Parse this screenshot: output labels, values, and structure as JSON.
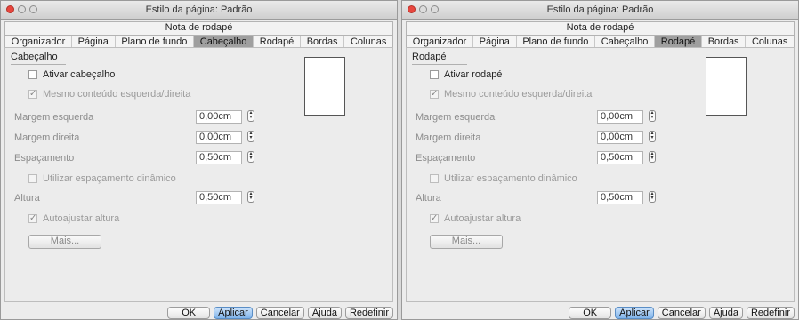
{
  "left": {
    "title": "Estilo da página: Padrão",
    "tabs_row1": "Nota de rodapé",
    "tabs": [
      "Organizador",
      "Página",
      "Plano de fundo",
      "Cabeçalho",
      "Rodapé",
      "Bordas",
      "Colunas"
    ],
    "active_tab": "Cabeçalho",
    "section_title": "Cabeçalho",
    "enable_label": "Ativar cabeçalho",
    "same_content_label": "Mesmo conteúdo esquerda/direita",
    "margin_left_label": "Margem esquerda",
    "margin_left_value": "0,00cm",
    "margin_right_label": "Margem direita",
    "margin_right_value": "0,00cm",
    "spacing_label": "Espaçamento",
    "spacing_value": "0,50cm",
    "dynamic_spacing_label": "Utilizar espaçamento dinâmico",
    "height_label": "Altura",
    "height_value": "0,50cm",
    "autofit_label": "Autoajustar altura",
    "more_label": "Mais...",
    "buttons": [
      "OK",
      "Aplicar",
      "Cancelar",
      "Ajuda",
      "Redefinir"
    ]
  },
  "right": {
    "title": "Estilo da página: Padrão",
    "tabs_row1": "Nota de rodapé",
    "tabs": [
      "Organizador",
      "Página",
      "Plano de fundo",
      "Cabeçalho",
      "Rodapé",
      "Bordas",
      "Colunas"
    ],
    "active_tab": "Rodapé",
    "section_title": "Rodapé",
    "enable_label": "Ativar rodapé",
    "same_content_label": "Mesmo conteúdo esquerda/direita",
    "margin_left_label": "Margem esquerda",
    "margin_left_value": "0,00cm",
    "margin_right_label": "Margem direita",
    "margin_right_value": "0,00cm",
    "spacing_label": "Espaçamento",
    "spacing_value": "0,50cm",
    "dynamic_spacing_label": "Utilizar espaçamento dinâmico",
    "height_label": "Altura",
    "height_value": "0,50cm",
    "autofit_label": "Autoajustar altura",
    "more_label": "Mais...",
    "buttons": [
      "OK",
      "Aplicar",
      "Cancelar",
      "Ajuda",
      "Redefinir"
    ]
  }
}
